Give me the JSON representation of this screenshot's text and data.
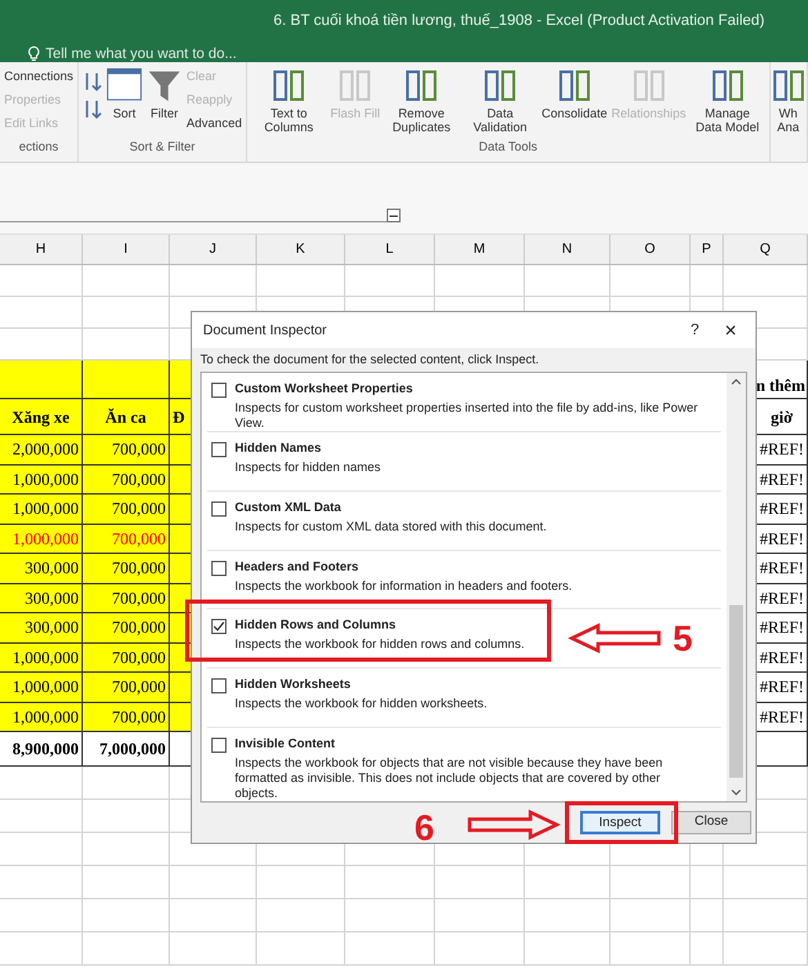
{
  "title_bar": {
    "title": "6. BT cuối khoá tiền lương, thuế_1908 - Excel (Product Activation Failed)",
    "tell_me": "Tell me what you want to do..."
  },
  "ribbon": {
    "groups": [
      {
        "label": "ections",
        "items": [
          {
            "label": "Connections",
            "kind": "small",
            "disabled": false
          },
          {
            "label": "Properties",
            "kind": "small",
            "disabled": true
          },
          {
            "label": "Edit Links",
            "kind": "small",
            "disabled": true
          }
        ]
      },
      {
        "label": "Sort & Filter",
        "items": [
          {
            "kind": "sortaz",
            "disabled": false
          },
          {
            "label": "Sort",
            "kind": "sort",
            "disabled": false
          },
          {
            "label": "Filter",
            "kind": "filter",
            "disabled": false
          },
          {
            "label": "Clear",
            "kind": "small",
            "disabled": true
          },
          {
            "label": "Reapply",
            "kind": "small",
            "disabled": true
          },
          {
            "label": "Advanced",
            "kind": "small",
            "disabled": false
          }
        ]
      },
      {
        "label": "Data Tools",
        "items": [
          {
            "label": "Text to Columns",
            "kind": "big",
            "disabled": false
          },
          {
            "label": "Flash Fill",
            "kind": "big",
            "disabled": true
          },
          {
            "label": "Remove Duplicates",
            "kind": "big",
            "disabled": false
          },
          {
            "label": "Data Validation",
            "kind": "big",
            "disabled": false
          },
          {
            "label": "Consolidate",
            "kind": "big",
            "disabled": false
          },
          {
            "label": "Relationships",
            "kind": "big",
            "disabled": true
          },
          {
            "label": "Manage Data Model",
            "kind": "big",
            "disabled": false
          }
        ]
      },
      {
        "items": [
          {
            "label": "Wh Ana",
            "kind": "big",
            "disabled": false
          }
        ]
      }
    ]
  },
  "sheet": {
    "columns": [
      "H",
      "I",
      "J",
      "K",
      "L",
      "M",
      "N",
      "O",
      "P",
      "Q"
    ],
    "group_header": "n thêm",
    "headers": [
      "Xăng xe",
      "Ăn ca",
      "Đ",
      "giờ"
    ],
    "rows": [
      {
        "cells": [
          "2,000,000",
          "700,000",
          "#REF!"
        ],
        "highlighted": false
      },
      {
        "cells": [
          "1,000,000",
          "700,000",
          "#REF!"
        ],
        "highlighted": false
      },
      {
        "cells": [
          "1,000,000",
          "700,000",
          "#REF!"
        ],
        "highlighted": false
      },
      {
        "cells": [
          "1,000,000",
          "700,000",
          "#REF!"
        ],
        "highlighted": true
      },
      {
        "cells": [
          "300,000",
          "700,000",
          "#REF!"
        ],
        "highlighted": false
      },
      {
        "cells": [
          "300,000",
          "700,000",
          "#REF!"
        ],
        "highlighted": false
      },
      {
        "cells": [
          "300,000",
          "700,000",
          "#REF!"
        ],
        "highlighted": false
      },
      {
        "cells": [
          "1,000,000",
          "700,000",
          "#REF!"
        ],
        "highlighted": false
      },
      {
        "cells": [
          "1,000,000",
          "700,000",
          "#REF!"
        ],
        "highlighted": false
      },
      {
        "cells": [
          "1,000,000",
          "700,000",
          "#REF!"
        ],
        "highlighted": false
      }
    ],
    "totals": [
      "8,900,000",
      "7,000,000"
    ]
  },
  "dialog": {
    "title": "Document Inspector",
    "help": "?",
    "close": "×",
    "instruction": "To check the document for the selected content, click Inspect.",
    "items": [
      {
        "title": "Custom Worksheet Properties",
        "description": "Inspects for custom worksheet properties inserted into the file by add-ins, like Power View.",
        "checked": false
      },
      {
        "title": "Hidden Names",
        "description": "Inspects for hidden names",
        "checked": false
      },
      {
        "title": "Custom XML Data",
        "description": "Inspects for custom XML data stored with this document.",
        "checked": false
      },
      {
        "title": "Headers and Footers",
        "description": "Inspects the workbook for information in headers and footers.",
        "checked": false
      },
      {
        "title": "Hidden Rows and Columns",
        "description": "Inspects the workbook for hidden rows and columns.",
        "checked": true
      },
      {
        "title": "Hidden Worksheets",
        "description": "Inspects the workbook for hidden worksheets.",
        "checked": false
      },
      {
        "title": "Invisible Content",
        "description": "Inspects the workbook for objects that are not visible because they have been formatted as invisible. This does not include objects that are covered by other objects.",
        "checked": false
      }
    ],
    "buttons": [
      {
        "label": "Inspect",
        "selected": true
      },
      {
        "label": "Close",
        "selected": false
      }
    ]
  },
  "annotations": [
    "5",
    "6"
  ]
}
